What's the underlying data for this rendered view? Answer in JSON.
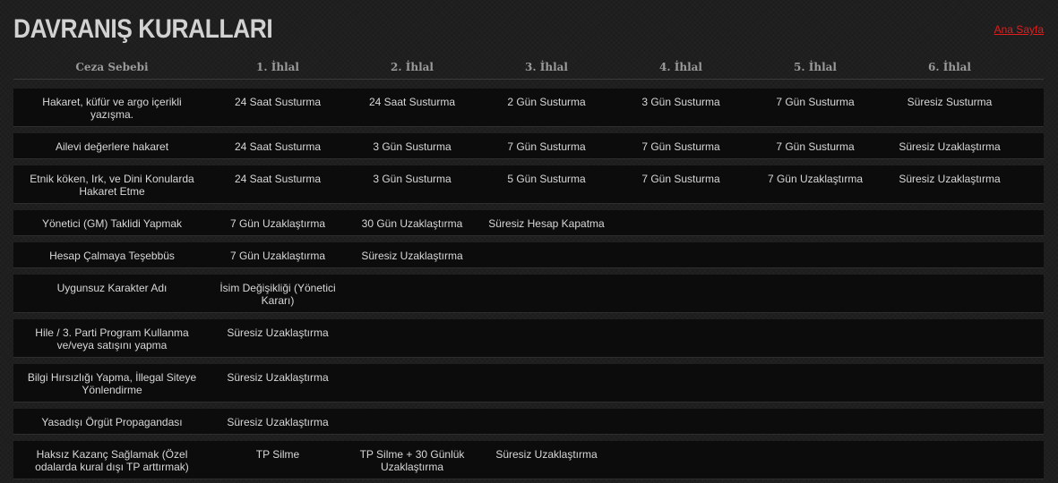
{
  "header": {
    "title": "DAVRANIŞ KURALLARI",
    "home_link": "Ana Sayfa"
  },
  "table": {
    "columns": [
      "Ceza Sebebi",
      "1. İhlal",
      "2. İhlal",
      "3. İhlal",
      "4. İhlal",
      "5. İhlal",
      "6. İhlal"
    ],
    "rows": [
      {
        "cells": [
          "Hakaret, küfür ve argo içerikli yazışma.",
          "24 Saat Susturma",
          "24 Saat Susturma",
          "2 Gün Susturma",
          "3 Gün Susturma",
          "7 Gün Susturma",
          "Süresiz Susturma"
        ]
      },
      {
        "cells": [
          "Ailevi değerlere hakaret",
          "24 Saat Susturma",
          "3 Gün Susturma",
          "7 Gün Susturma",
          "7 Gün Susturma",
          "7 Gün Susturma",
          "Süresiz Uzaklaştırma"
        ]
      },
      {
        "cells": [
          "Etnik köken, Irk, ve Dini Konularda Hakaret Etme",
          "24 Saat Susturma",
          "3 Gün Susturma",
          "5 Gün Susturma",
          "7 Gün Susturma",
          "7 Gün Uzaklaştırma",
          "Süresiz Uzaklaştırma"
        ]
      },
      {
        "cells": [
          "Yönetici (GM) Taklidi Yapmak",
          "7 Gün Uzaklaştırma",
          "30 Gün Uzaklaştırma",
          "Süresiz Hesap Kapatma",
          "",
          "",
          ""
        ]
      },
      {
        "cells": [
          "Hesap Çalmaya Teşebbüs",
          "7 Gün Uzaklaştırma",
          "Süresiz Uzaklaştırma",
          "",
          "",
          "",
          ""
        ]
      },
      {
        "cells": [
          "Uygunsuz Karakter Adı",
          "İsim Değişikliği (Yönetici Kararı)",
          "",
          "",
          "",
          "",
          ""
        ]
      },
      {
        "cells": [
          "Hile / 3. Parti Program Kullanma ve/veya satışını yapma",
          "Süresiz Uzaklaştırma",
          "",
          "",
          "",
          "",
          ""
        ]
      },
      {
        "cells": [
          "Bilgi Hırsızlığı Yapma, İllegal Siteye Yönlendirme",
          "Süresiz Uzaklaştırma",
          "",
          "",
          "",
          "",
          ""
        ]
      },
      {
        "cells": [
          "Yasadışı Örgüt Propagandası",
          "Süresiz Uzaklaştırma",
          "",
          "",
          "",
          "",
          ""
        ]
      },
      {
        "cells": [
          "Haksız Kazanç Sağlamak (Özel odalarda kural dışı TP arttırmak)",
          "TP Silme",
          "TP Silme + 30 Günlük Uzaklaştırma",
          "Süresiz Uzaklaştırma",
          "",
          "",
          ""
        ]
      }
    ]
  },
  "colors": {
    "title": "#d2d2d2",
    "link": "#e01e1e",
    "header_text": "#9a9a9a",
    "cell_text": "#d8d8d8",
    "row_bg": "#0c0c0c"
  }
}
